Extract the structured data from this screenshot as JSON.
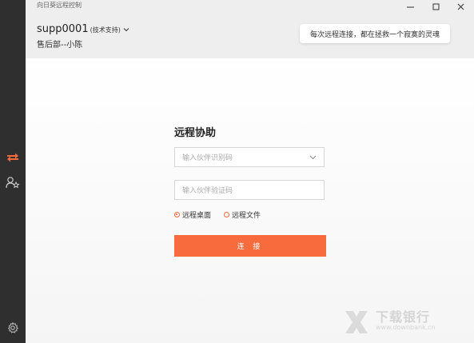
{
  "window": {
    "title": "向日葵远程控制"
  },
  "sidebar": {
    "items": [
      {
        "icon": "remote-assist-icon",
        "active": true,
        "color": "#f46a3c"
      },
      {
        "icon": "contacts-icon",
        "active": false
      }
    ],
    "settings_icon": "gear-icon"
  },
  "header": {
    "user_id": "supp0001",
    "user_tag": "(技术支持)",
    "user_name": "售后部--小陈",
    "bubble_text": "每次远程连接，都在拯救一个寂寞的灵魂"
  },
  "form": {
    "title": "远程协助",
    "partner_id_placeholder": "输入伙伴识别码",
    "partner_code_placeholder": "输入伙伴验证码",
    "mode_options": [
      {
        "label": "远程桌面",
        "selected": true
      },
      {
        "label": "远程文件",
        "selected": false
      }
    ],
    "connect_label": "连 接"
  },
  "watermark": {
    "line1": "下载银行",
    "line2": "www.downbank.cn"
  },
  "colors": {
    "accent": "#f76b3c",
    "sidebar": "#2f2f2f",
    "header": "#eeeeee"
  }
}
